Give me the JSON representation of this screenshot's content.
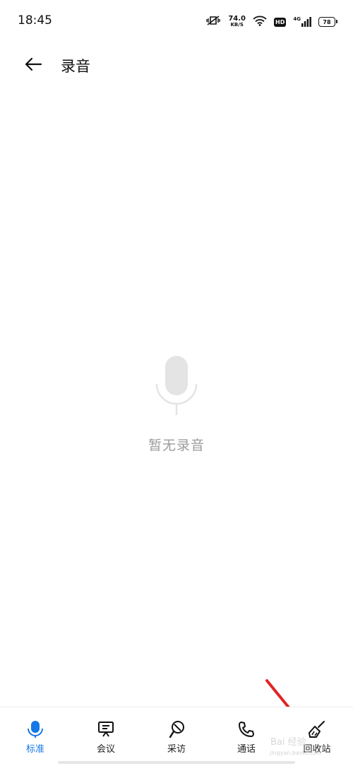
{
  "status_bar": {
    "time": "18:45",
    "net_speed_value": "74.0",
    "net_speed_unit": "KB/S",
    "hd_label": "HD",
    "network_label": "4G",
    "battery": "78"
  },
  "header": {
    "title": "录音"
  },
  "empty_state": {
    "text": "暂无录音"
  },
  "tabs": [
    {
      "label": "标准",
      "icon": "microphone-icon",
      "active": true
    },
    {
      "label": "会议",
      "icon": "meeting-icon",
      "active": false
    },
    {
      "label": "采访",
      "icon": "interview-icon",
      "active": false
    },
    {
      "label": "通话",
      "icon": "phone-icon",
      "active": false
    },
    {
      "label": "回收站",
      "icon": "broom-icon",
      "active": false
    }
  ],
  "colors": {
    "accent": "#1677e6",
    "annotation_arrow": "#e02424",
    "empty_icon": "#e0e0e0"
  },
  "watermark": {
    "text": "Bai 经验",
    "sub": "jingyan.baidu.com"
  }
}
